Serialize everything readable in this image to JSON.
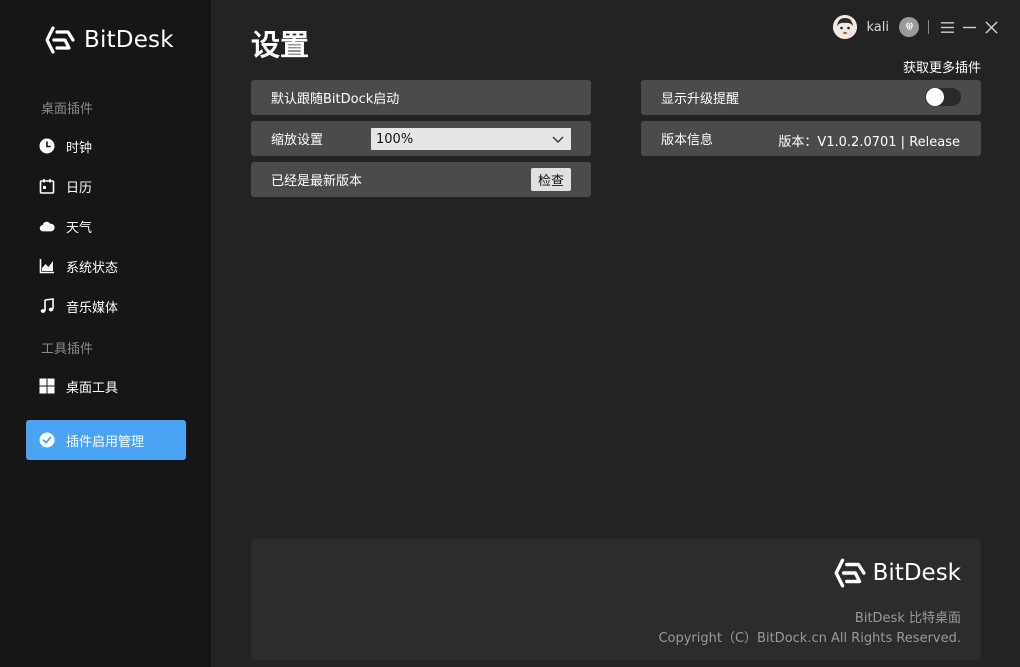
{
  "app": {
    "brand": "BitDesk"
  },
  "sidebar": {
    "section_desktop": "桌面插件",
    "section_tools": "工具插件",
    "items": [
      {
        "label": "时钟",
        "icon": "clock-icon"
      },
      {
        "label": "日历",
        "icon": "calendar-icon"
      },
      {
        "label": "天气",
        "icon": "cloud-icon"
      },
      {
        "label": "系统状态",
        "icon": "chart-icon"
      },
      {
        "label": "音乐媒体",
        "icon": "music-note-icon"
      },
      {
        "label": "桌面工具",
        "icon": "grid-icon"
      },
      {
        "label": "插件启用管理",
        "icon": "check-circle-icon",
        "active": true
      }
    ]
  },
  "page": {
    "title": "设置"
  },
  "topbar": {
    "username": "kali",
    "more_plugins": "获取更多插件"
  },
  "settings": {
    "autostart_label": "默认跟随BitDock启动",
    "scale_label": "缩放设置",
    "scale_value": "100%",
    "update_status": "已经是最新版本",
    "check_button": "检查",
    "upgrade_reminder_label": "显示升级提醒",
    "upgrade_reminder_on": false,
    "version_label": "版本信息",
    "version_value": "版本：V1.0.2.0701 | Release"
  },
  "footer": {
    "brand": "BitDesk",
    "line1": "BitDesk 比特桌面",
    "line2": "Copyright（C）BitDock.cn All Rights Reserved."
  },
  "colors": {
    "accent": "#4aa3f3",
    "sidebar_bg": "#161617",
    "main_bg": "#232325",
    "row_bg": "#4b4b4d"
  }
}
